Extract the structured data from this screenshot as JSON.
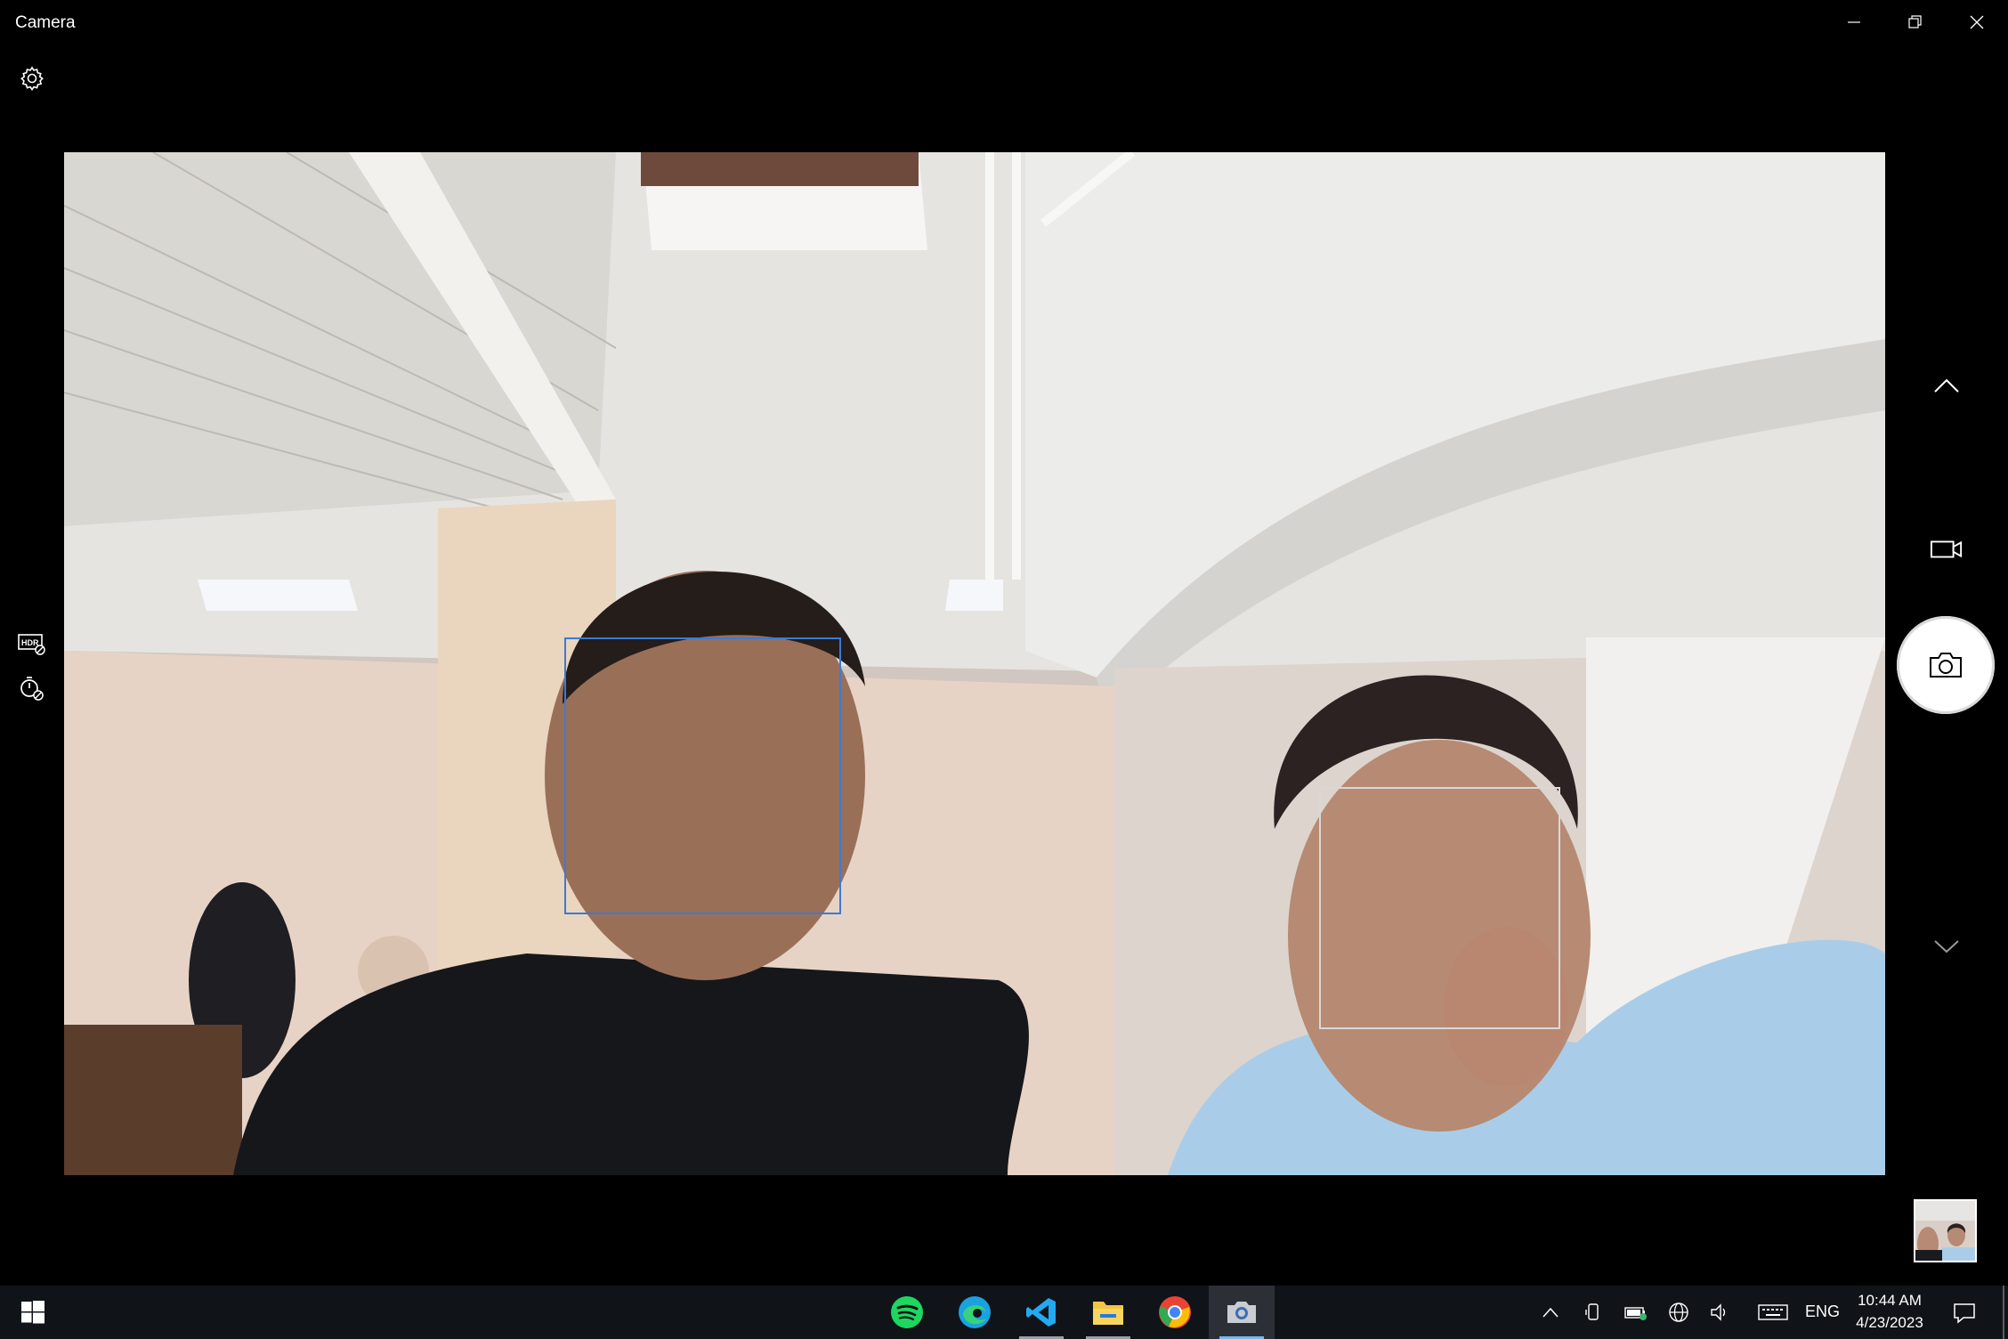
{
  "window": {
    "title": "Camera",
    "controls": [
      "minimize",
      "restore",
      "close"
    ]
  },
  "toolbar": {
    "settings_icon": "gear-icon"
  },
  "left_tools": [
    {
      "name": "hdr-off-icon"
    },
    {
      "name": "timer-off-icon"
    }
  ],
  "right_controls": {
    "mode_up": "chevron-up-icon",
    "video_mode": "video-camera-icon",
    "shutter": "camera-icon",
    "mode_down": "chevron-down-icon"
  },
  "viewfinder": {
    "faces_detected": 2,
    "colors": {
      "face_primary": "#3a7bd5",
      "face_secondary": "#d8d8d8"
    }
  },
  "taskbar": {
    "apps": [
      {
        "name": "spotify",
        "color": "#1ed760"
      },
      {
        "name": "edge",
        "color": "#1aa1e0"
      },
      {
        "name": "vscode",
        "color": "#23a9f2"
      },
      {
        "name": "file-explorer",
        "color": "#f4c543"
      },
      {
        "name": "chrome",
        "color": "#ea4335"
      },
      {
        "name": "camera",
        "color": "#c9ccd1"
      }
    ],
    "language": "ENG",
    "time": "10:44 AM",
    "date": "4/23/2023"
  }
}
